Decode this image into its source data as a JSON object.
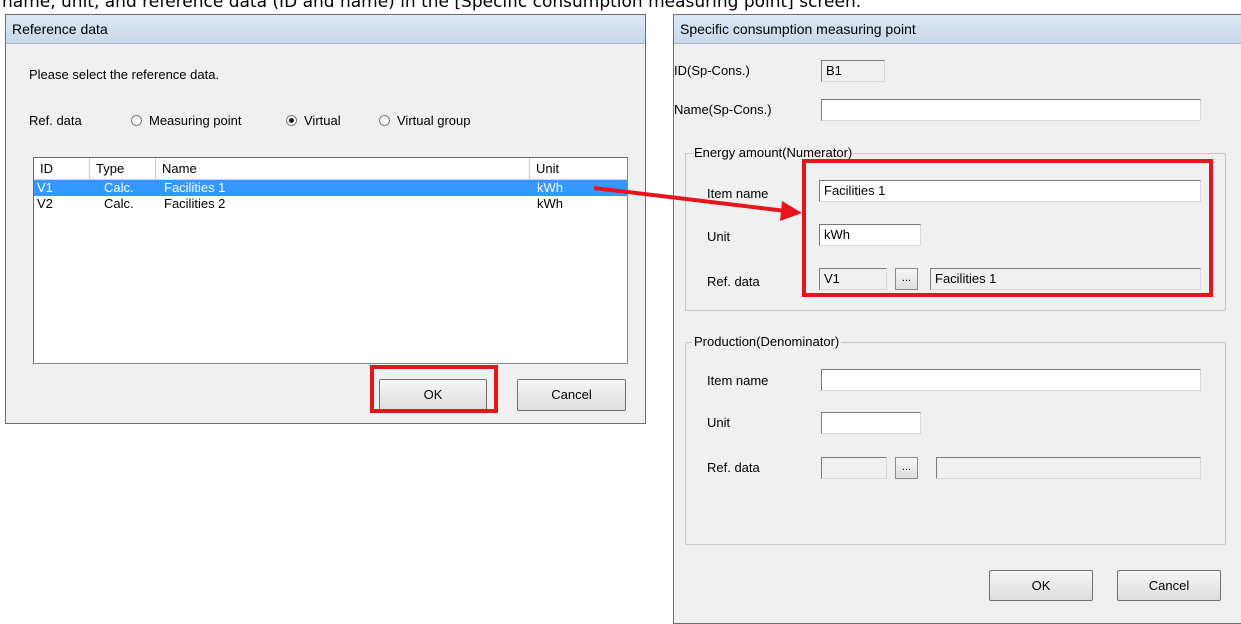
{
  "caption": "name, unit, and reference data (ID and name) in the [Specific consumption measuring point] screen.",
  "accent_color": "#e8141b",
  "reference_dialog": {
    "title": "Reference data",
    "prompt": "Please select the reference data.",
    "ref_label": "Ref. data",
    "options": [
      {
        "label": "Measuring point",
        "selected": false
      },
      {
        "label": "Virtual",
        "selected": true
      },
      {
        "label": "Virtual group",
        "selected": false
      }
    ],
    "columns": [
      "ID",
      "Type",
      "Name",
      "Unit"
    ],
    "rows": [
      {
        "id": "V1",
        "type": "Calc.",
        "name": "Facilities 1",
        "unit": "kWh",
        "selected": true
      },
      {
        "id": "V2",
        "type": "Calc.",
        "name": "Facilities 2",
        "unit": "kWh",
        "selected": false
      }
    ],
    "ok_label": "OK",
    "cancel_label": "Cancel"
  },
  "sp_dialog": {
    "title": "Specific consumption measuring point",
    "id_label": "ID(Sp-Cons.)",
    "id_value": "B1",
    "name_label": "Name(Sp-Cons.)",
    "name_value": "",
    "numerator": {
      "title": "Energy amount(Numerator)",
      "item_label": "Item name",
      "item_value": "Facilities 1",
      "unit_label": "Unit",
      "unit_value": "kWh",
      "ref_label": "Ref. data",
      "ref_id": "V1",
      "browse_label": "...",
      "ref_name": "Facilities 1"
    },
    "denominator": {
      "title": "Production(Denominator)",
      "item_label": "Item name",
      "item_value": "",
      "unit_label": "Unit",
      "unit_value": "",
      "ref_label": "Ref. data",
      "ref_id": "",
      "browse_label": "...",
      "ref_name": ""
    },
    "ok_label": "OK",
    "cancel_label": "Cancel"
  }
}
